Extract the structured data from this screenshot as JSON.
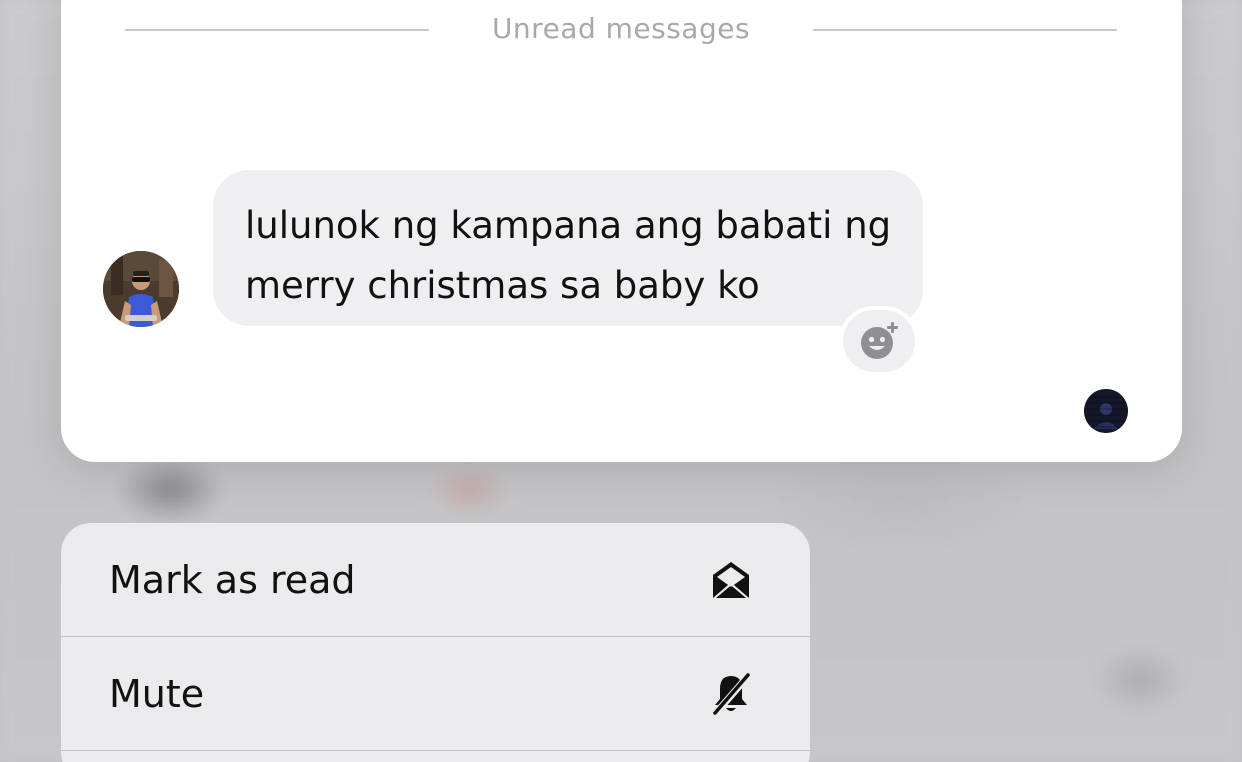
{
  "chat": {
    "divider_label": "Unread messages",
    "message": {
      "text_line1": "lulunok ng kampana ang babati ng",
      "text_line2": "merry christmas sa baby ko"
    },
    "reaction_icon": "add-reaction-icon"
  },
  "menu": {
    "items": [
      {
        "label": "Mark as read",
        "icon": "open-envelope-icon"
      },
      {
        "label": "Mute",
        "icon": "bell-slash-icon"
      }
    ]
  }
}
